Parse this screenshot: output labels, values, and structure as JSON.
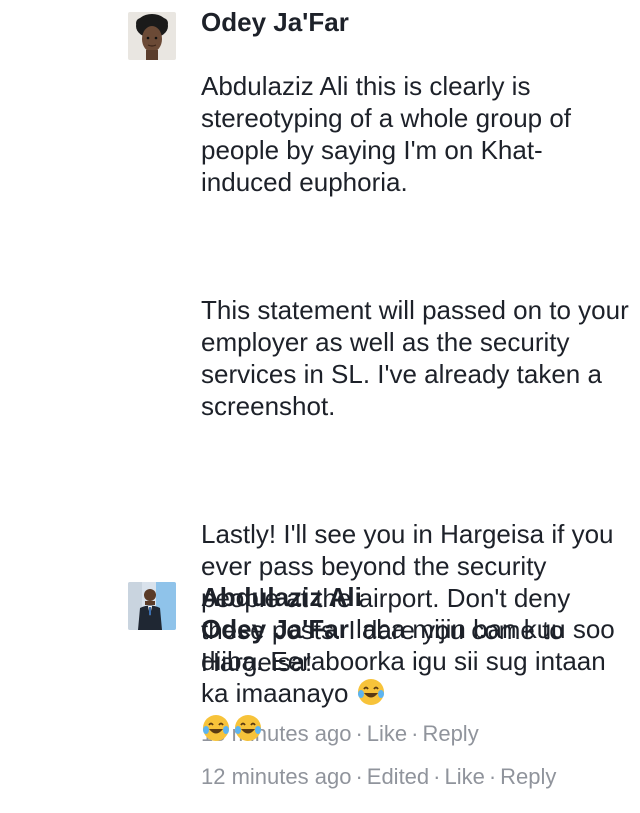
{
  "comments": [
    {
      "author": "Odey Ja'Far",
      "paragraphs": [
        "Abdulaziz Ali this is clearly is stereotyping of a whole group of people by saying I'm on Khat-induced euphoria.",
        "This statement will passed on to your employer as well as the security services in SL. I've already taken a screenshot.",
        "Lastly! I'll see you in Hargeisa if you ever pass beyond the security people at the airport. Don't deny these posts. I dare you come to Hargeisa!"
      ],
      "time": "13 minutes ago",
      "like": "Like",
      "reply": "Reply"
    },
    {
      "author": "Abdulaziz Ali",
      "mention": "Odey Ja'Far",
      "text": "laba mijin ban kuu soo diiba. Eeraboorka igu sii sug intaan ka imaanayo",
      "time": "12 minutes ago",
      "edited": "Edited",
      "like": "Like",
      "reply": "Reply"
    }
  ],
  "icons": {
    "laugh_emoji": "face-with-tears-of-joy-icon"
  },
  "colors": {
    "text": "#1d2129",
    "meta": "#90949c",
    "emoji_face": "#f7c33a"
  }
}
